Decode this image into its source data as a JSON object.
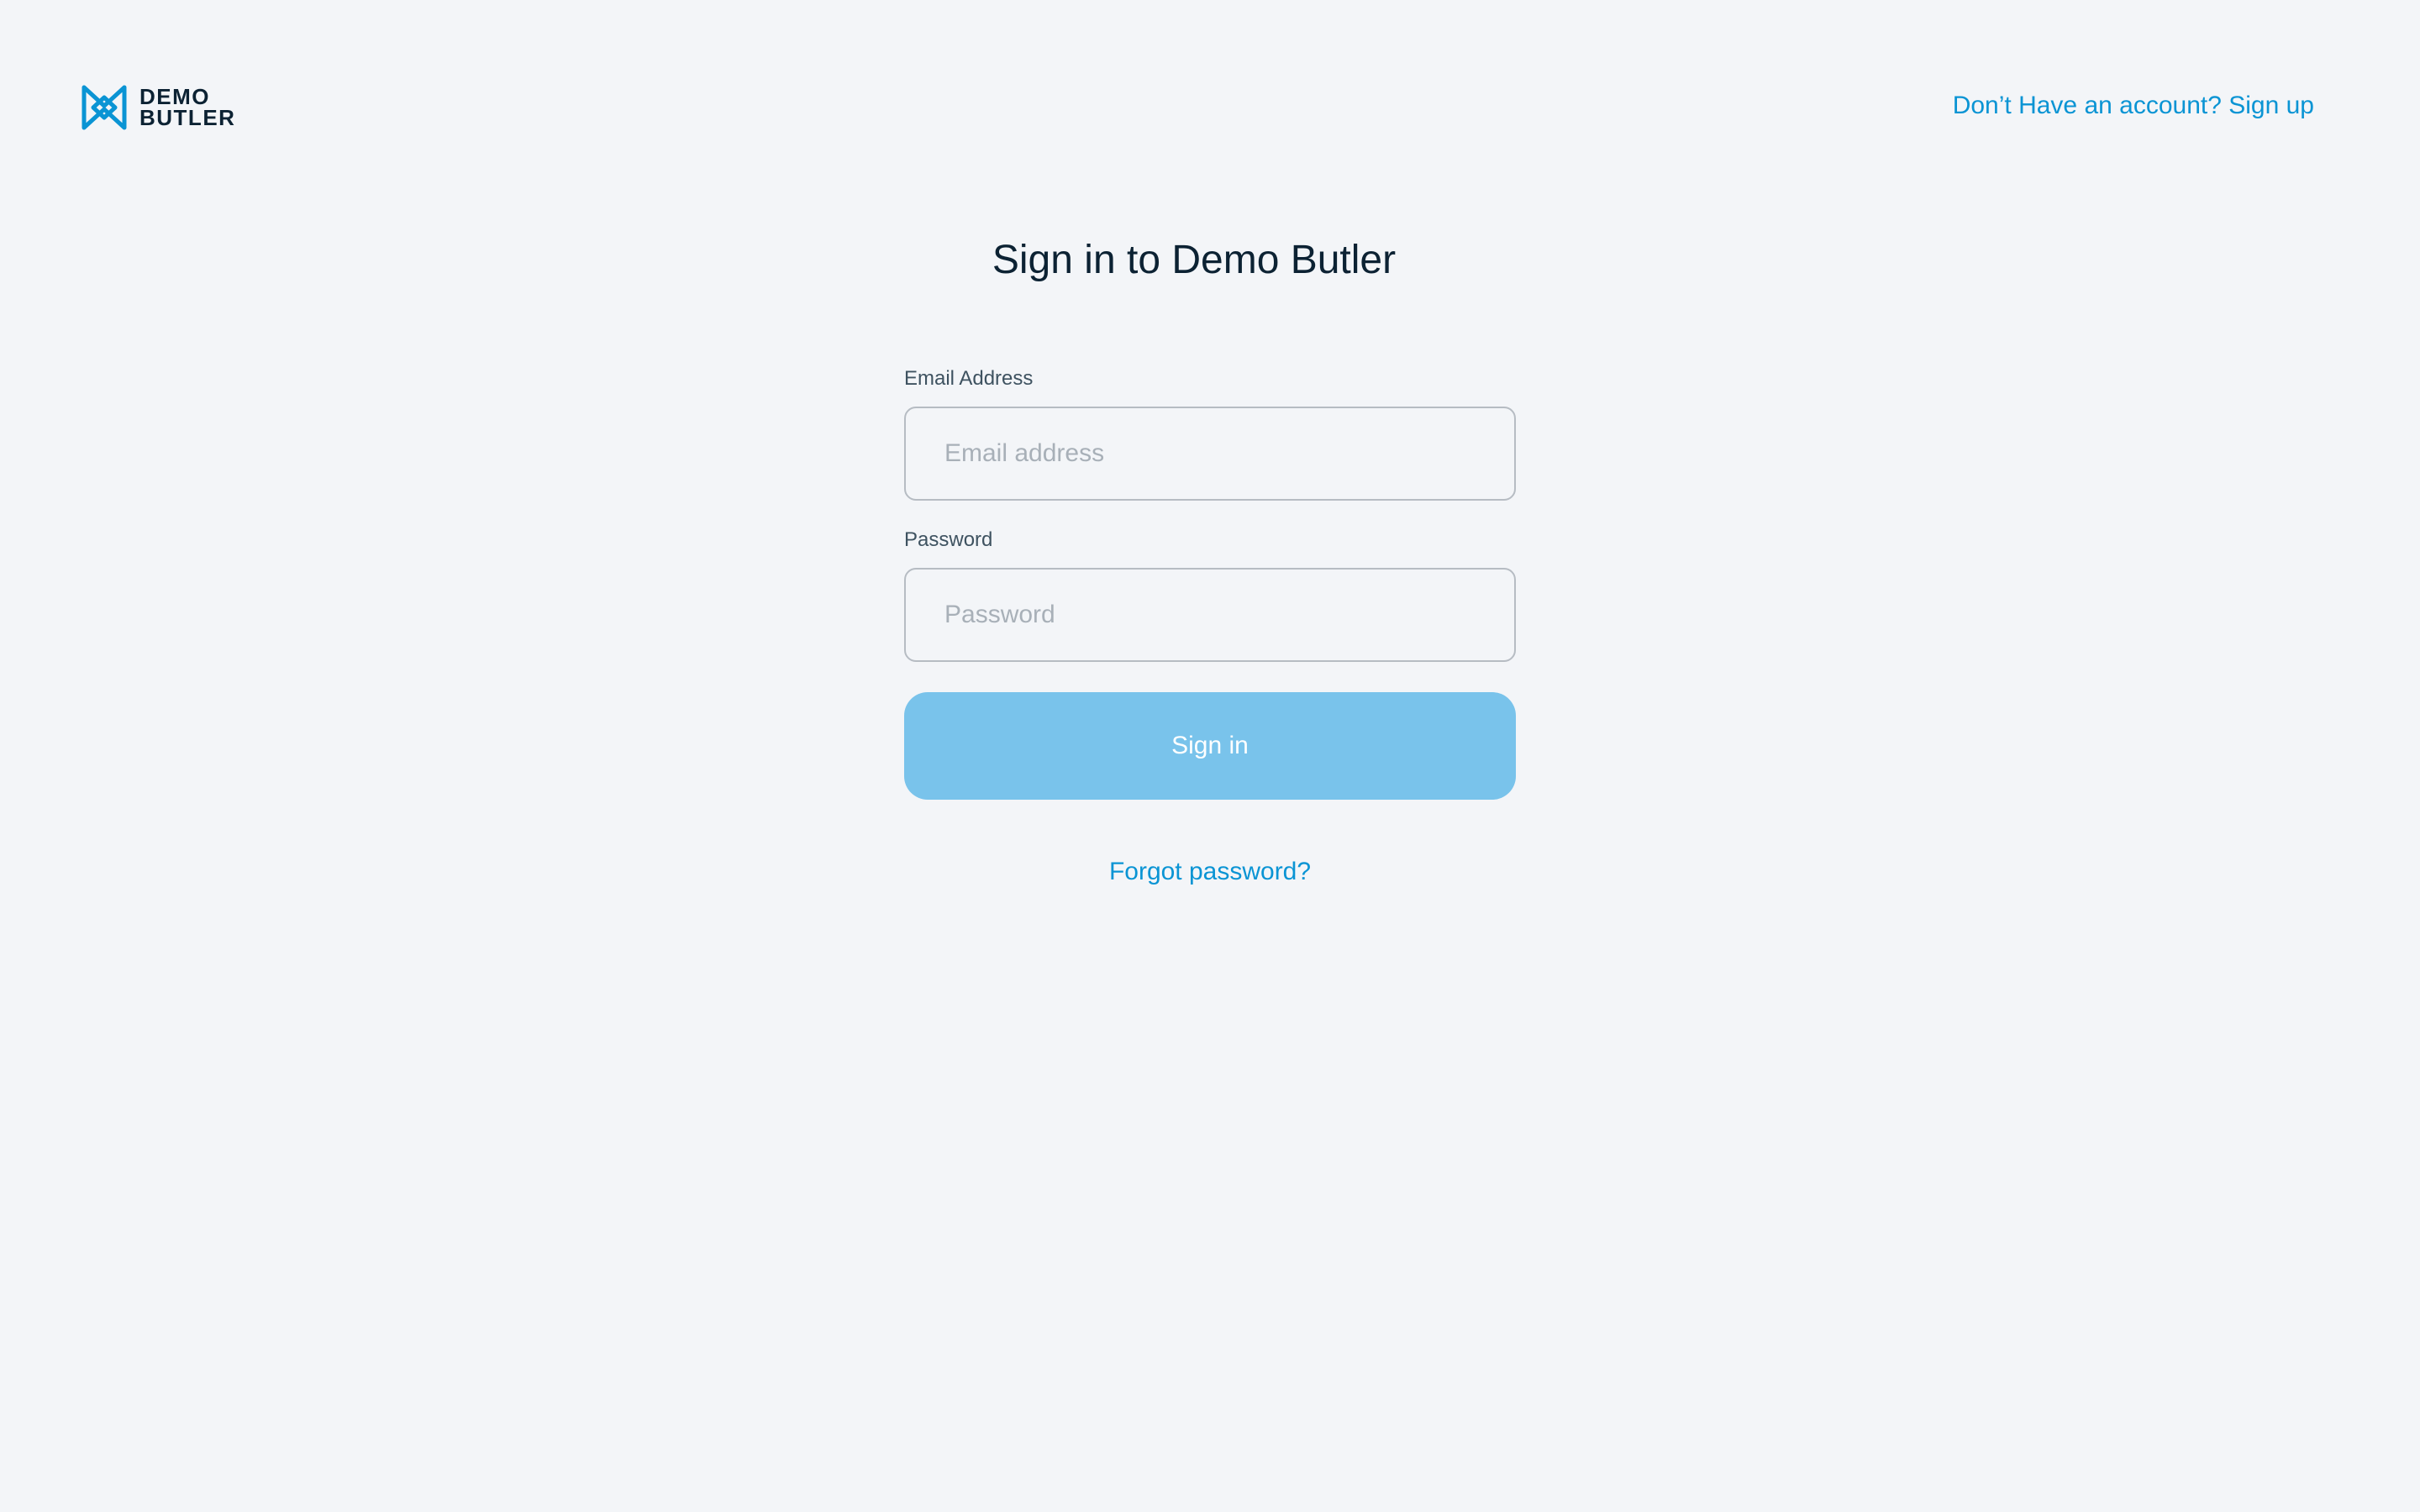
{
  "brand": {
    "icon": "bowtie-logo-icon",
    "line1": "DEMO",
    "line2": "BUTLER",
    "accent_color": "#0a94d4",
    "text_color": "#0c2233"
  },
  "header": {
    "signup_link": "Don’t Have an account? Sign up"
  },
  "main": {
    "title": "Sign in to Demo Butler"
  },
  "form": {
    "email": {
      "label": "Email Address",
      "placeholder": "Email address",
      "value": ""
    },
    "password": {
      "label": "Password",
      "placeholder": "Password",
      "value": ""
    },
    "submit_label": "Sign in",
    "submit_color": "#79c3eb",
    "forgot_link": "Forgot password?"
  }
}
